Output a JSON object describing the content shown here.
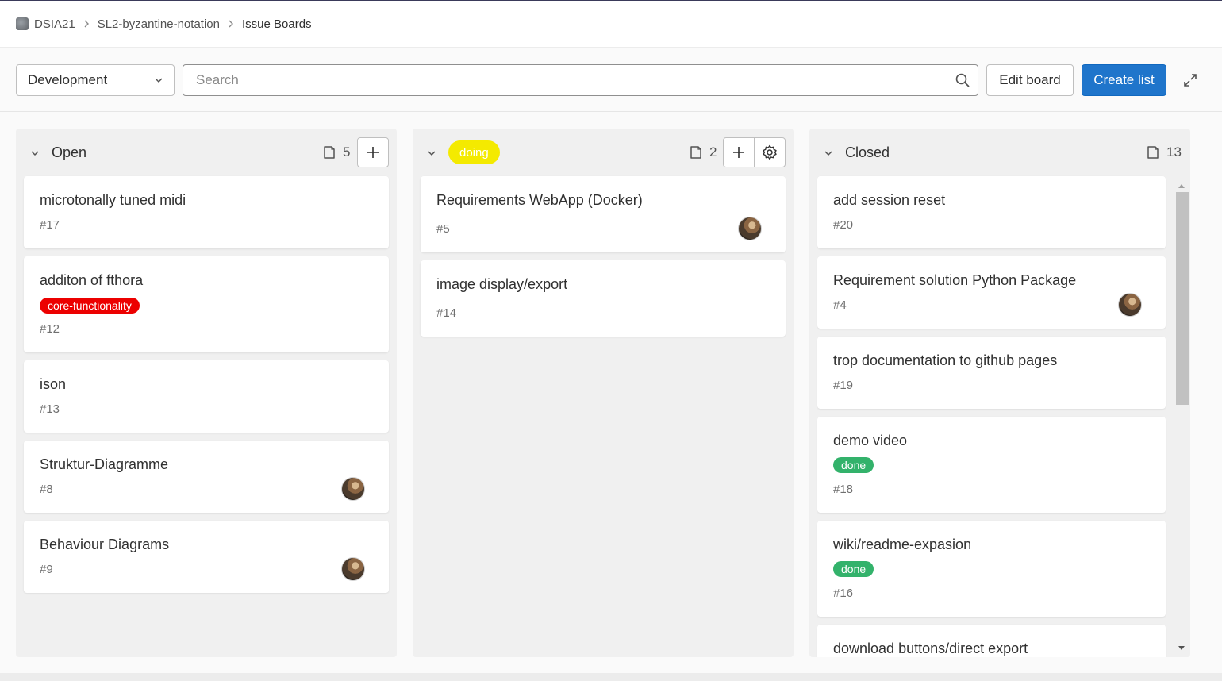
{
  "breadcrumb": {
    "group": "DSIA21",
    "project": "SL2-byzantine-notation",
    "current": "Issue Boards"
  },
  "toolbar": {
    "board_select": "Development",
    "search_placeholder": "Search",
    "edit_board": "Edit board",
    "create_list": "Create list"
  },
  "lists": [
    {
      "title": "Open",
      "count": "5",
      "cards": [
        {
          "title": "microtonally tuned midi",
          "number": "#17"
        },
        {
          "title": "additon of fthora",
          "number": "#12",
          "label": "core-functionality"
        },
        {
          "title": "ison",
          "number": "#13"
        },
        {
          "title": "Struktur-Diagramme",
          "number": "#8"
        },
        {
          "title": "Behaviour Diagrams",
          "number": "#9"
        }
      ]
    },
    {
      "title": "doing",
      "count": "2",
      "cards": [
        {
          "title": "Requirements WebApp (Docker)",
          "number": "#5"
        },
        {
          "title": "image display/export",
          "number": "#14"
        }
      ]
    },
    {
      "title": "Closed",
      "count": "13",
      "cards": [
        {
          "title": "add session reset",
          "number": "#20"
        },
        {
          "title": "Requirement solution Python Package",
          "number": "#4"
        },
        {
          "title": "trop documentation to github pages",
          "number": "#19"
        },
        {
          "title": "demo video",
          "number": "#18",
          "label": "done"
        },
        {
          "title": "wiki/readme-expasion",
          "number": "#16",
          "label": "done"
        },
        {
          "title": "download buttons/direct export"
        }
      ]
    }
  ],
  "colors": {
    "primary": "#1f75cb",
    "doing_label": "#f4ea00",
    "core_functionality_label": "#ec0000",
    "done_label": "#33b26b"
  },
  "icons": {
    "chevron": "chevron-down-icon",
    "issues": "issues-icon",
    "plus": "plus-icon",
    "settings": "settings-icon",
    "search": "search-icon",
    "maximize": "maximize-icon"
  }
}
